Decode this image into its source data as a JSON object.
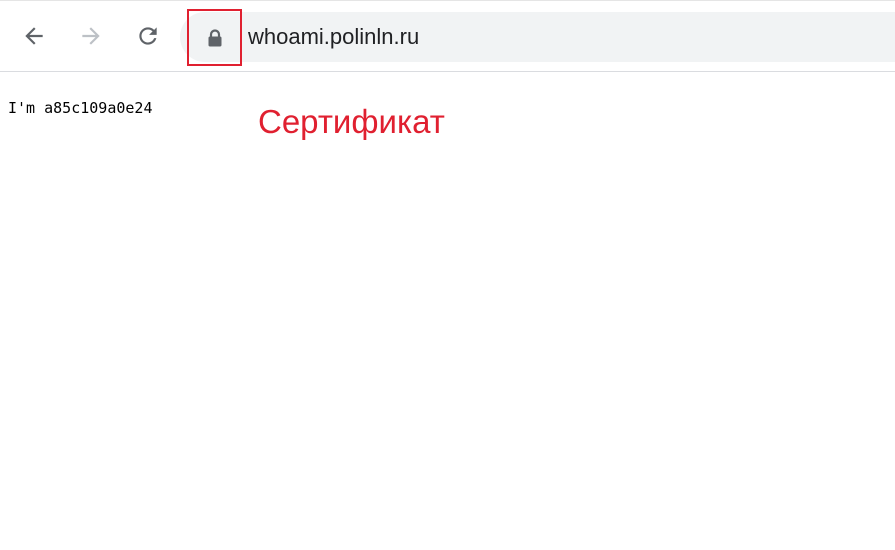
{
  "browser": {
    "toolbar": {
      "back_icon": "arrow-left-icon",
      "forward_icon": "arrow-right-icon",
      "reload_icon": "reload-icon",
      "forward_disabled": true
    },
    "address_bar": {
      "security_icon": "lock-icon",
      "url": "whoami.polinln.ru"
    }
  },
  "page": {
    "body_text": "I'm a85c109a0e24"
  },
  "annotation": {
    "label": "Сертификат",
    "color": "#e02030"
  }
}
